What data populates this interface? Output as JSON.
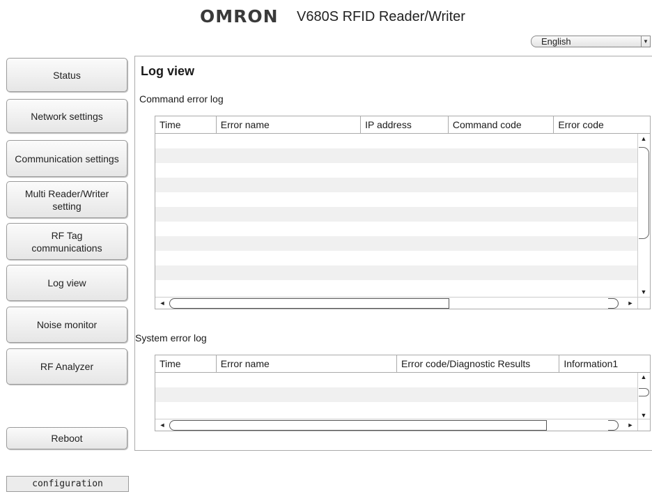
{
  "header": {
    "logo": "OMRON",
    "title": "V680S RFID Reader/Writer"
  },
  "language": {
    "selected": "English"
  },
  "sidebar": {
    "items": [
      {
        "label": "Status"
      },
      {
        "label": "Network settings"
      },
      {
        "label": "Communication settings"
      },
      {
        "label": "Multi Reader/Writer setting"
      },
      {
        "label": "RF Tag communications"
      },
      {
        "label": "Log view"
      },
      {
        "label": "Noise monitor"
      },
      {
        "label": "RF Analyzer"
      }
    ],
    "reboot_label": "Reboot",
    "configuration_label": "configuration"
  },
  "main": {
    "title": "Log view",
    "command_log": {
      "label": "Command error log",
      "columns": [
        "Time",
        "Error name",
        "IP address",
        "Command code",
        "Error code"
      ],
      "rows": []
    },
    "system_log": {
      "label": "System error log",
      "columns": [
        "Time",
        "Error name",
        "Error code/Diagnostic Results",
        "Information1"
      ],
      "rows": []
    }
  },
  "icons": {
    "scroll_up": "scroll-up-arrow-icon",
    "scroll_down": "scroll-down-arrow-icon",
    "scroll_left": "scroll-left-arrow-icon",
    "scroll_right": "scroll-right-arrow-icon",
    "dropdown": "chevron-down-icon"
  }
}
